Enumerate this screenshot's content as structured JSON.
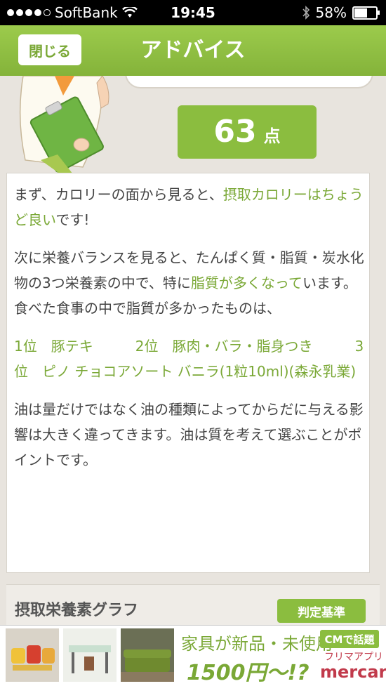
{
  "status_bar": {
    "carrier": "SoftBank",
    "time": "19:45",
    "battery_percent": "58%",
    "battery_level": 0.58
  },
  "navbar": {
    "close_label": "閉じる",
    "title": "アドバイス"
  },
  "score": {
    "value": "63",
    "unit": "点"
  },
  "advice": {
    "p1": [
      {
        "text": "まず、カロリーの面から見ると、",
        "highlight": false
      },
      {
        "text": "摂取カロリーはちょうど良い",
        "highlight": true
      },
      {
        "text": "です!",
        "highlight": false
      }
    ],
    "p2": [
      {
        "text": "次に栄養バランスを見ると、たんぱく質・脂質・炭水化物の3つ栄養素の中で、特に",
        "highlight": false
      },
      {
        "text": "脂質が多くなって",
        "highlight": true
      },
      {
        "text": "います。食べた食事の中で脂質が多かったものは、",
        "highlight": false
      }
    ],
    "ranking": "1位　豚テキ　　　2位　豚肉・バラ・脂身つき　　　3位　ピノ チョコアソート バニラ(1粒10ml)(森永乳業)",
    "p4": "油は量だけではなく油の種類によってからだに与える影響は大きく違ってきます。油は質を考えて選ぶことがポイントです。"
  },
  "graph": {
    "title": "摂取栄養素グラフ",
    "criteria_label": "判定基準"
  },
  "ad": {
    "headline": "家具が新品・未使用",
    "price": "1500円〜!?",
    "cm_badge": "CMで話題",
    "app_label": "フリマアプリ",
    "brand": "mercari"
  },
  "colors": {
    "accent": "#8bbd3f",
    "highlight_text": "#7aa836",
    "background": "#e8e4de"
  }
}
